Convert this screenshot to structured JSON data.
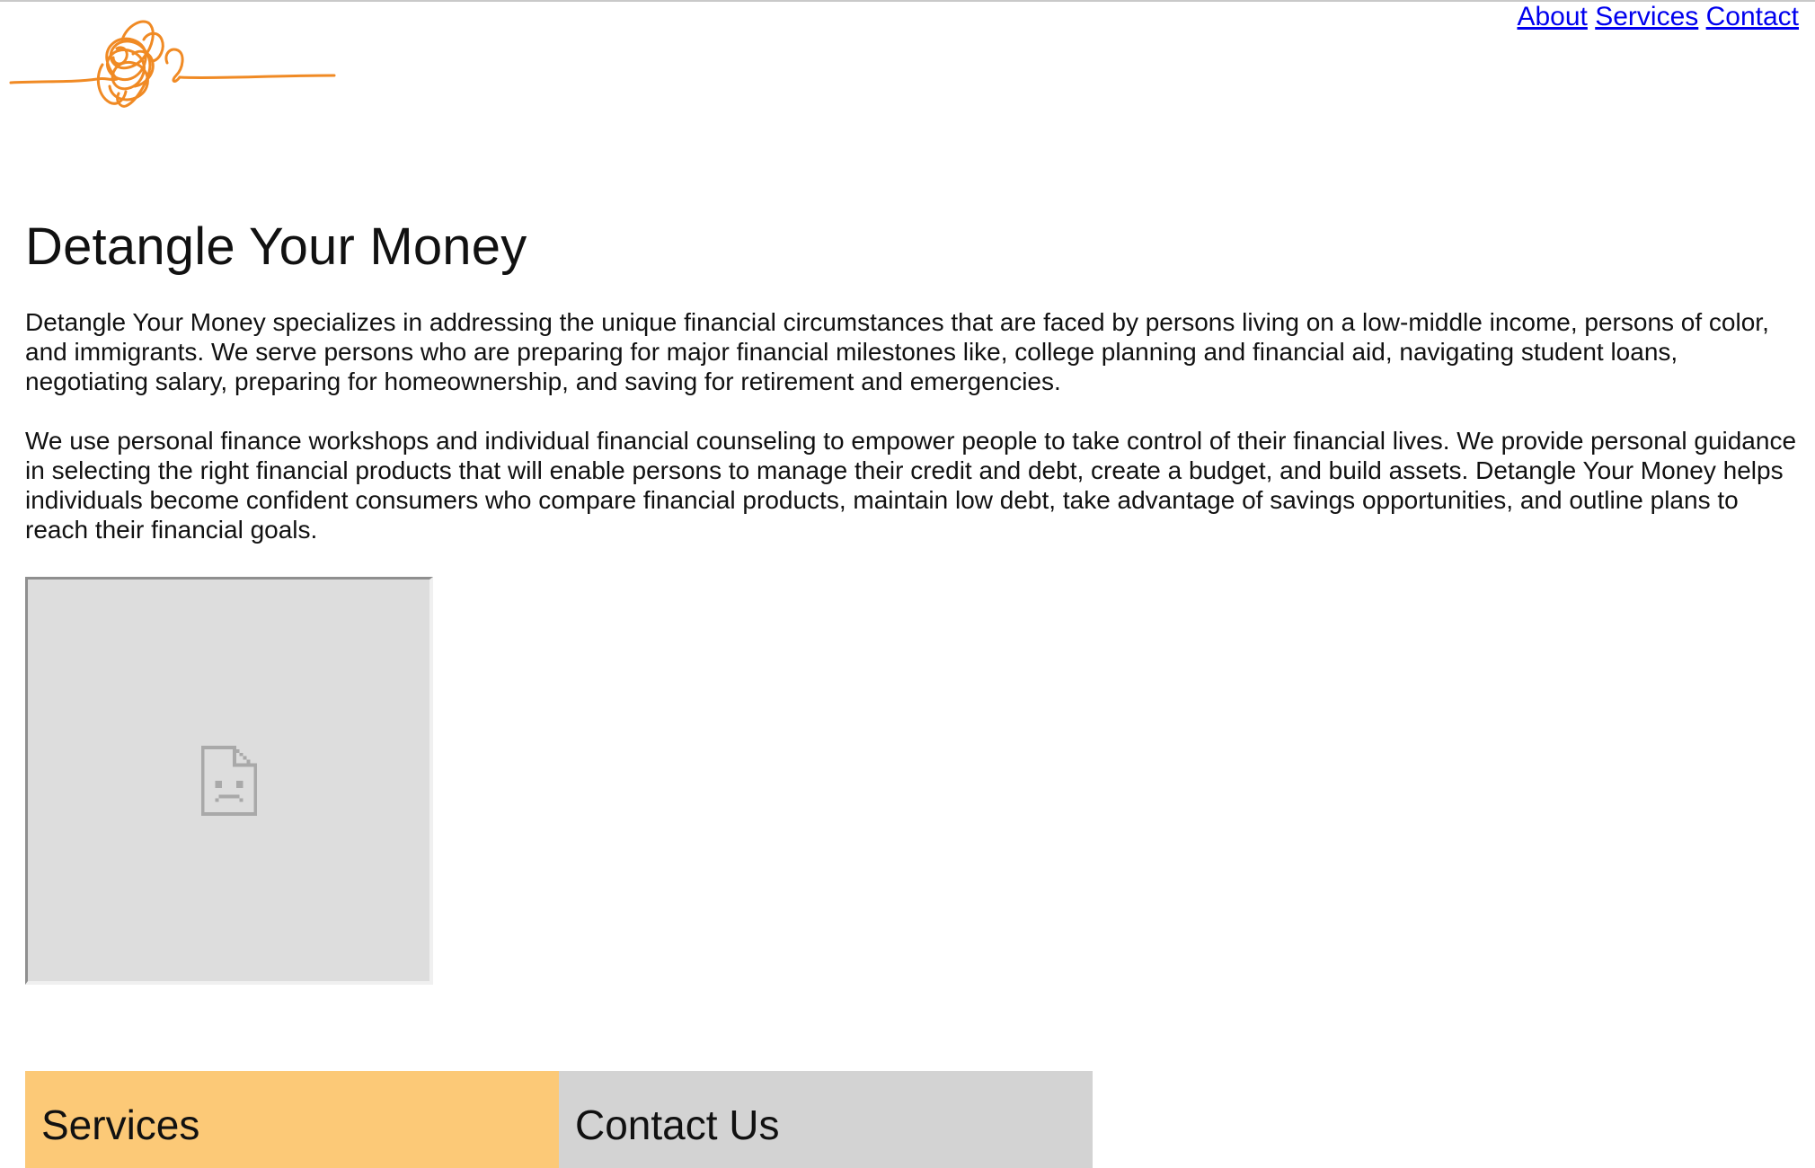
{
  "nav": {
    "about": "About",
    "services": "Services",
    "contact": "Contact"
  },
  "logo": {
    "icon": "tangled-scribble-logo",
    "color": "#f08a24"
  },
  "main": {
    "title": "Detangle Your Money",
    "paragraphs": [
      "Detangle Your Money specializes in addressing the unique financial circumstances that are faced by persons living on a low-middle income, persons of color, and immigrants. We serve persons who are preparing for major financial milestones like, college planning and financial aid, navigating student loans, negotiating salary, preparing for homeownership, and saving for retirement and emergencies.",
      "We use personal finance workshops and individual financial counseling to empower people to take control of their financial lives. We provide personal guidance in selecting the right financial products that will enable persons to manage their credit and debt, create a budget, and build assets. Detangle Your Money helps individuals become confident consumers who compare financial products, maintain low debt, take advantage of savings opportunities, and outline plans to reach their financial goals."
    ],
    "image": {
      "icon": "broken-image-icon"
    }
  },
  "tiles": [
    {
      "label": "Services",
      "color": "#fcc977"
    },
    {
      "label": "Contact Us",
      "color": "#d3d3d3"
    }
  ]
}
